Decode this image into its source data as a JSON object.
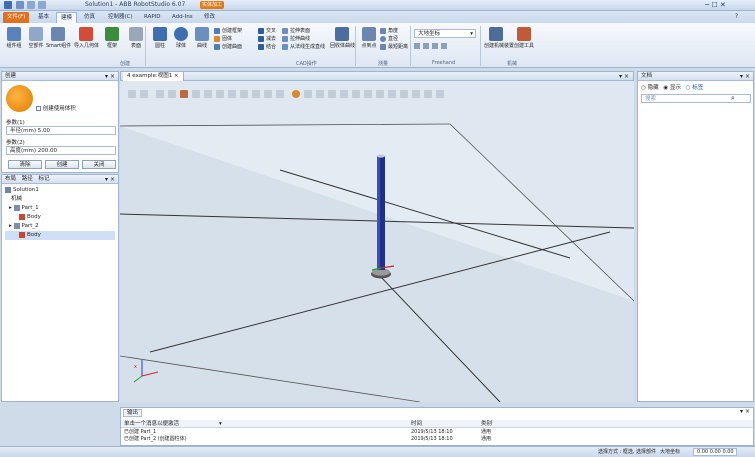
{
  "window": {
    "title": "Solution1 - ABB RobotStudio 6.07",
    "badge": "实体加工",
    "quick_access": [
      "save-icon",
      "undo-icon",
      "redo-icon"
    ]
  },
  "tabs": {
    "file": "文件(F)",
    "items": [
      "基本",
      "建模",
      "仿真",
      "控制器(C)",
      "RAPID",
      "Add-Ins",
      "修改"
    ],
    "active_index": 1
  },
  "ribbon": {
    "buttons": {
      "component_group": "组件组",
      "empty_part": "空部件",
      "smart_component": "Smart组件",
      "import_geometry": "导入几何体",
      "frame": "框架",
      "surface": "表面"
    },
    "create_small": [
      "创建框架",
      "固体"
    ],
    "modify_small": [
      "创建曲面",
      "结合"
    ],
    "solid_buttons": {
      "box": "圆柱",
      "sphere": "球体",
      "curve": "曲线"
    },
    "cad_items": [
      "交叉",
      "减去",
      "结合",
      "拉伸表面",
      "拉伸曲线",
      "从法线生成直线"
    ],
    "cad_labels_b": [
      "回收体曲线",
      "分割"
    ],
    "measure_buttons": {
      "points": "点到点",
      "angle": "角度",
      "diameter": "直径",
      "min_dist": "最短距离"
    },
    "freehand_select": "大地坐标",
    "mechanism_buttons": {
      "create_mechanism": "创建机械装置",
      "create_tool": "创建工具"
    },
    "groups": [
      "创建",
      "CAD操作",
      "测量",
      "Freehand",
      "机械"
    ]
  },
  "left_panel": {
    "title": "创建",
    "pin": "▾ ×",
    "check_label": "创建使用体积",
    "field1_label": "参数(1)",
    "field1_value": "半径(mm) 5.00",
    "field2_label": "参数(2)",
    "field2_value": "高度(mm) 200.00",
    "buttons": [
      "清除",
      "创建",
      "关闭"
    ]
  },
  "layout_panel": {
    "tabs": [
      "布局",
      "路径",
      "标记"
    ],
    "pin": "▾ ×",
    "tree": [
      "Solution1",
      "机械",
      "Part_1",
      "Body",
      "Part_2",
      "Body"
    ]
  },
  "doc_tab": {
    "label": "4 example:视图1",
    "close": "×"
  },
  "doc_tab_controls": "▾ ×",
  "right_panel": {
    "title": "文档",
    "pin": "▾ ×",
    "filter": [
      "隐藏",
      "显示",
      "标签"
    ],
    "search_placeholder": "搜索"
  },
  "output": {
    "tab": "输出",
    "columns": [
      "单击一个消息以便激活",
      "时间",
      "类别"
    ],
    "rows": [
      [
        "已创建 Part_1",
        "2019/5/13 18:10",
        "通用"
      ],
      [
        "已创建 Part_2 (创建圆柱体)",
        "2019/5/13 18:10",
        "通用"
      ]
    ],
    "pin": "▾ ×"
  },
  "statusbar": {
    "text": "选择方式 : 框选, 选择部件",
    "coords": "0.00  0.00  0.00",
    "mode": "大地坐标"
  },
  "colors": {
    "file_tab": "#e0701e",
    "accent": "#3c6fb4",
    "cylinder": "#1f2f8c",
    "floor": "#dfe8f0"
  }
}
